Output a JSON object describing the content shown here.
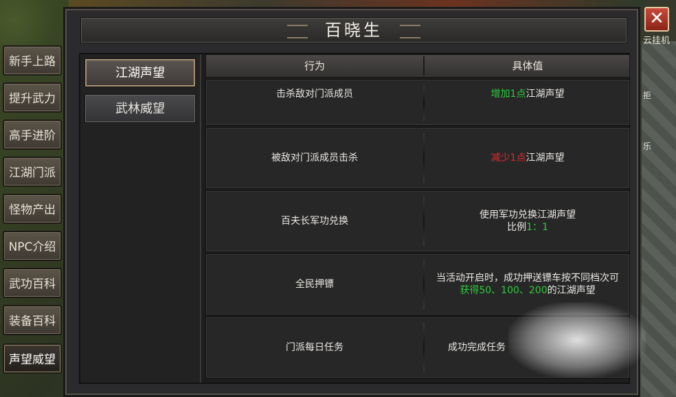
{
  "window": {
    "title": "百晓生",
    "close_label": "✕"
  },
  "side_tabs": [
    {
      "label": "新手上路",
      "active": false
    },
    {
      "label": "提升武力",
      "active": false
    },
    {
      "label": "高手进阶",
      "active": false
    },
    {
      "label": "江湖门派",
      "active": false
    },
    {
      "label": "怪物产出",
      "active": false
    },
    {
      "label": "NPC介绍",
      "active": false
    },
    {
      "label": "武功百科",
      "active": false
    },
    {
      "label": "装备百科",
      "active": false
    },
    {
      "label": "声望威望",
      "active": true
    }
  ],
  "sub_tabs": [
    {
      "label": "江湖声望",
      "active": true
    },
    {
      "label": "武林威望",
      "active": false
    }
  ],
  "table": {
    "headers": [
      "行为",
      "具体值"
    ],
    "rows": [
      {
        "action": "击杀敌对门派成员",
        "value_hl": "增加1点",
        "value_rest": "江湖声望",
        "hl_color": "green"
      },
      {
        "action": "被敌对门派成员击杀",
        "value_hl": "减少1点",
        "value_rest": "江湖声望",
        "hl_color": "red"
      },
      {
        "action": "百夫长军功兑换",
        "value_line1": "使用军功兑换江湖声望",
        "value_line2_prefix": "比例",
        "value_line2_hl": "1：1"
      },
      {
        "action": "全民押镖",
        "value_line1": "当活动开启时，成功押送镖车按不同档次可",
        "value_line2_hl": "获得50、100、200",
        "value_line2_rest": "的江湖声望"
      },
      {
        "action": "门派每日任务",
        "value_text": "成功完成任务"
      }
    ]
  },
  "right_hud": {
    "label_top": "云挂机",
    "label_mid": "拒",
    "label_low": "乐"
  },
  "colors": {
    "highlight_green": "#2ecc3d",
    "highlight_red": "#e02a2a",
    "accent_border": "#a89170"
  }
}
